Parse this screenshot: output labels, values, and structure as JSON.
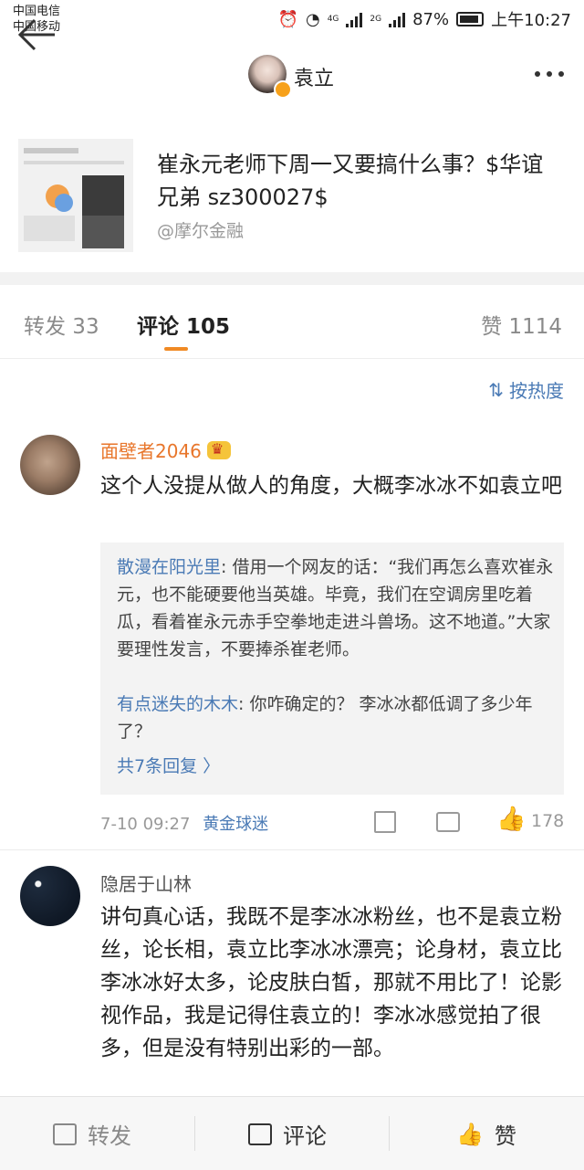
{
  "status_bar": {
    "carrier_1": "中国电信",
    "carrier_2": "中国移动",
    "network_1": "4G",
    "network_2": "2G",
    "battery": "87%",
    "time": "上午10:27"
  },
  "nav": {
    "title": "袁立",
    "back_icon": "arrow-left-icon",
    "more_icon": "more-dots-icon"
  },
  "shared_post": {
    "title": "崔永元老师下周一又要搞什么事？$华谊兄弟 sz300027$",
    "source": "@摩尔金融"
  },
  "tabs": {
    "forward": "转发 33",
    "comments": "评论 105",
    "likes": "赞 1114"
  },
  "sort_label": "按热度",
  "comments": [
    {
      "author": "面壁者2046",
      "text": "这个人没提从做人的角度，大概李冰冰不如袁立吧",
      "replies": [
        {
          "name": "散漫在阳光里",
          "text": ": 借用一个网友的话：“我们再怎么喜欢崔永元，也不能硬要他当英雄。毕竟，我们在空调房里吃着瓜，看着崔永元赤手空拳地走进斗兽场。这不地道。”大家要理性发言，不要捧杀崔老师。"
        },
        {
          "name": "有点迷失的木木",
          "text": ": 你咋确定的？ 李冰冰都低调了多少年了？"
        }
      ],
      "more_replies": "共7条回复 〉",
      "time": "7-10 09:27",
      "source": "黄金球迷",
      "likes": "178"
    },
    {
      "author": "隐居于山林",
      "text": "讲句真心话，我既不是李冰冰粉丝，也不是袁立粉丝，论长相，袁立比李冰冰漂亮；论身材，袁立比李冰冰好太多，论皮肤白皙，那就不用比了！论影视作品，我是记得住袁立的！李冰冰感觉拍了很多，但是没有特别出彩的一部。"
    }
  ],
  "bottom_bar": {
    "forward": "转发",
    "comment": "评论",
    "like": "赞"
  }
}
